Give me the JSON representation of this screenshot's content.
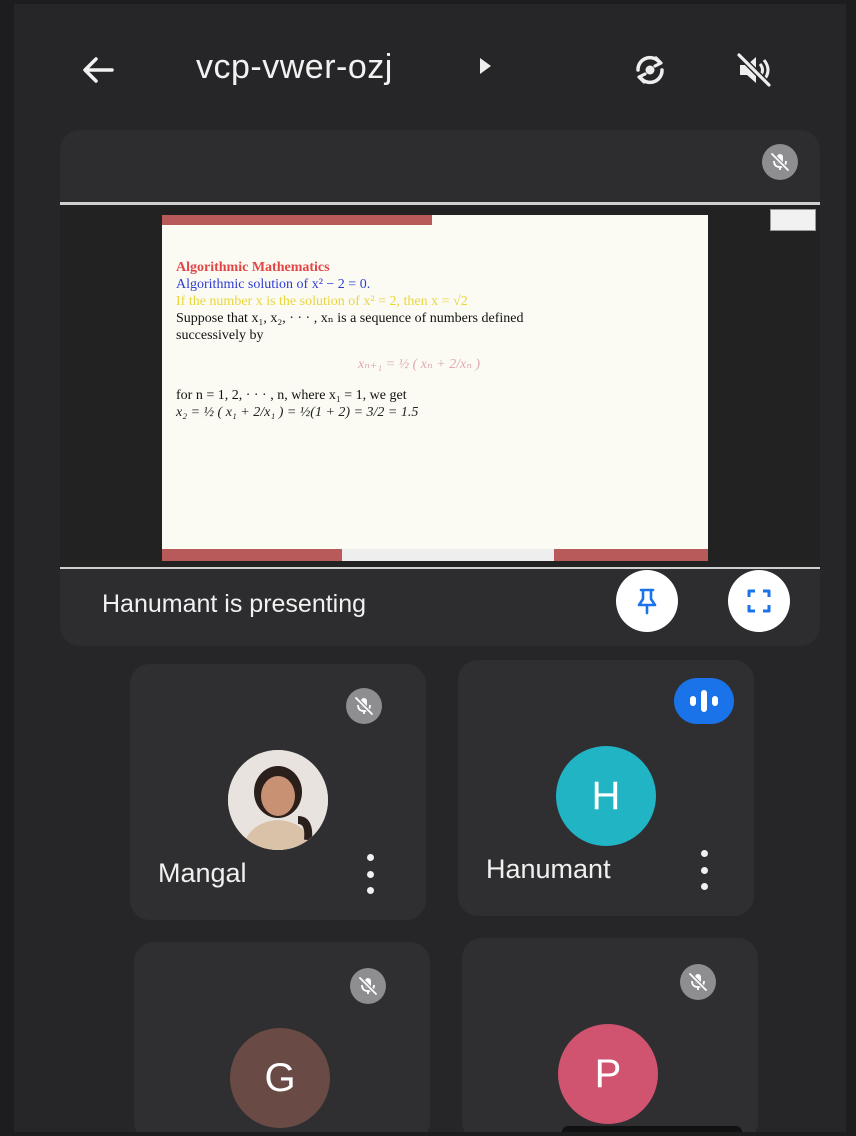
{
  "header": {
    "back_icon": "arrow-left-icon",
    "meeting_code": "vcp-vwer-ozj",
    "caret_icon": "caret-right-icon",
    "switch_camera_icon": "switch-camera-icon",
    "audio_icon": "volume-off-icon"
  },
  "presentation": {
    "mute_icon": "mic-off-icon",
    "slide": {
      "title": "Algorithmic Mathematics",
      "line2": "Algorithmic solution of x² − 2 = 0.",
      "line3": "If the number x is the solution of x² = 2, then x = √2",
      "line4": "Suppose that x₁, x₂, · · · , xₙ is a sequence of numbers defined",
      "line5": "successively by",
      "formula": "xₙ₊₁ = ½ ( xₙ + 2/xₙ )",
      "line6": "for n = 1, 2, · · · , n, where x₁ = 1, we get",
      "line7": "x₂ = ½ ( x₁ + 2/x₁ ) = ½(1 + 2) = 3/2 = 1.5"
    },
    "status_text": "Hanumant is presenting",
    "pin_icon": "pin-icon",
    "fullscreen_icon": "fullscreen-icon"
  },
  "participants": [
    {
      "name": "Mangal",
      "initial": "",
      "avatar": "photo",
      "status": "muted",
      "color": "#e8e3df"
    },
    {
      "name": "Hanumant",
      "initial": "H",
      "avatar": "letter",
      "status": "speaking",
      "color": "#20b4c4"
    },
    {
      "name": "",
      "initial": "G",
      "avatar": "letter",
      "status": "muted",
      "color": "#6a4a45"
    },
    {
      "name": "",
      "initial": "P",
      "avatar": "letter",
      "status": "muted",
      "color": "#d05470"
    }
  ],
  "colors": {
    "background": "#262628",
    "tile": "#2f2f31",
    "accent_blue": "#1a73e8",
    "muted_badge": "#8e8e90"
  }
}
